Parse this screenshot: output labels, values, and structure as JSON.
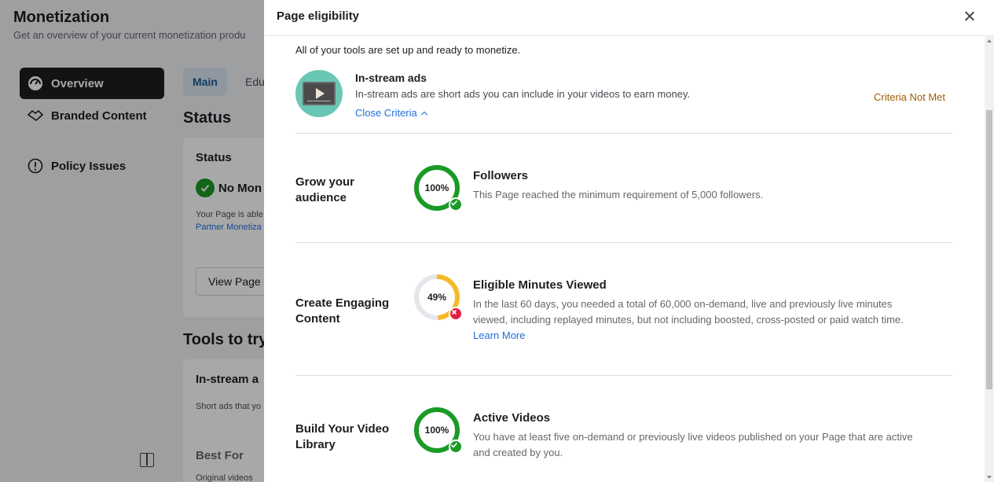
{
  "background": {
    "page_title": "Monetization",
    "page_subtitle": "Get an overview of your current monetization produ",
    "nav": [
      {
        "label": "Overview",
        "icon": "dashboard-icon"
      },
      {
        "label": "Branded Content",
        "icon": "handshake-icon"
      },
      {
        "label": "Policy Issues",
        "icon": "alert-circle-icon"
      }
    ],
    "tabs": [
      "Main",
      "Edu"
    ],
    "status_heading": "Status",
    "status_card": {
      "title": "Status",
      "state": "No Mon",
      "text": "Your Page is able",
      "link": "Partner Monetiza",
      "button": "View Page"
    },
    "tools_heading": "Tools to try",
    "tool_card": {
      "title": "In-stream a",
      "text": "Short ads that yo",
      "best_for": "Best For",
      "best_for_text": "Original videos"
    }
  },
  "dialog": {
    "title": "Page eligibility",
    "intro": "All of your tools are set up and ready to monetize.",
    "tool": {
      "name": "In-stream ads",
      "description": "In-stream ads are short ads you can include in your videos to earn money.",
      "toggle_label": "Close Criteria",
      "status": "Criteria Not Met",
      "icon": "video-play-icon"
    },
    "criteria": [
      {
        "category": "Grow your audience",
        "percent": 100,
        "percent_label": "100%",
        "met": true,
        "title": "Followers",
        "description": "This Page reached the minimum requirement of 5,000 followers.",
        "link": ""
      },
      {
        "category": "Create Engaging Content",
        "percent": 49,
        "percent_label": "49%",
        "met": false,
        "title": "Eligible Minutes Viewed",
        "description": "In the last 60 days, you needed a total of 60,000 on-demand, live and previously live minutes viewed, including replayed minutes, but not including boosted, cross-posted or paid watch time.",
        "link": "Learn More"
      },
      {
        "category": "Build Your Video Library",
        "percent": 100,
        "percent_label": "100%",
        "met": true,
        "title": "Active Videos",
        "description": "You have at least five on-demand or previously live videos published on your Page that are active and created by you.",
        "link": ""
      }
    ]
  },
  "colors": {
    "ring_complete": "#1a9a27",
    "ring_partial": "#f7b928",
    "ring_track": "#e4e6eb",
    "warning_text": "#a35d00",
    "link": "#216fdb"
  }
}
